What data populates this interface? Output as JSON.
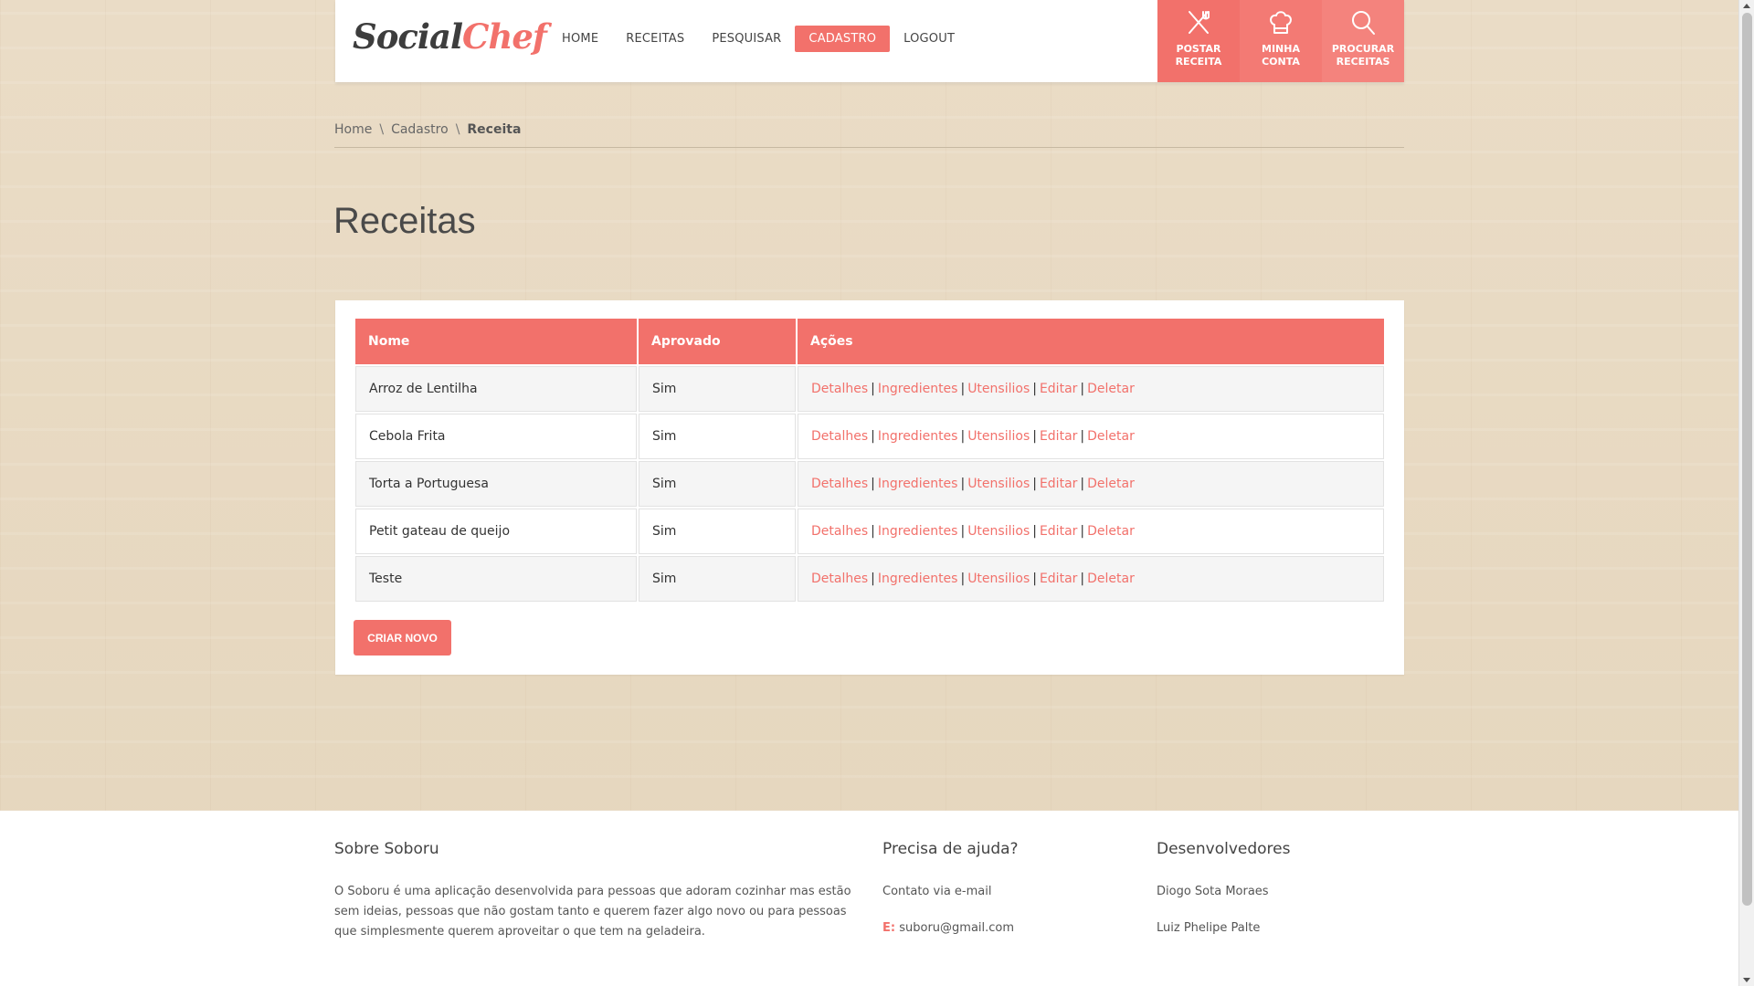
{
  "header": {
    "logo_part1": "Social",
    "logo_part2": "Chef",
    "nav": [
      "HOME",
      "RECEITAS",
      "PESQUISAR",
      "CADASTRO",
      "LOGOUT"
    ],
    "tiles": [
      {
        "line1": "POSTAR",
        "line2": "RECEITA",
        "icon": "fork-knife-icon"
      },
      {
        "line1": "MINHA",
        "line2": "CONTA",
        "icon": "chef-hat-icon"
      },
      {
        "line1": "PROCURAR",
        "line2": "RECEITAS",
        "icon": "search-icon"
      }
    ]
  },
  "breadcrumb": [
    "Home",
    "Cadastro",
    "Receita"
  ],
  "page_title": "Receitas",
  "table": {
    "headers": [
      "Nome",
      "Aprovado",
      "Ações"
    ],
    "rows": [
      {
        "nome": "Arroz de Lentilha",
        "aprovado": "Sim"
      },
      {
        "nome": "Cebola Frita",
        "aprovado": "Sim"
      },
      {
        "nome": "Torta a Portuguesa",
        "aprovado": "Sim"
      },
      {
        "nome": "Petit gateau de queijo",
        "aprovado": "Sim"
      },
      {
        "nome": "Teste",
        "aprovado": "Sim"
      }
    ],
    "actions": [
      "Detalhes",
      "Ingredientes",
      "Utensilios",
      "Editar",
      "Deletar"
    ]
  },
  "create_button": "CRIAR NOVO",
  "footer": {
    "about_title": "Sobre Soboru",
    "about_text": "O Soboru é uma aplicação desenvolvida para pessoas que adoram cozinhar mas estão sem ideias, pessoas que não gostam tanto e querem fazer algo novo ou para pessoas que simplesmente querem aproveitar o que tem na geladeira.",
    "help_title": "Precisa de ajuda?",
    "help_contact": "Contato via e-mail",
    "help_email_label": "E:",
    "help_email": "suboru@gmail.com",
    "dev_title": "Desenvolvedores",
    "devs": [
      "Diogo Sota Moraes",
      "Luiz Phelipe Palte"
    ]
  },
  "colors": {
    "accent": "#f2716b",
    "background": "#e7d9c2"
  }
}
